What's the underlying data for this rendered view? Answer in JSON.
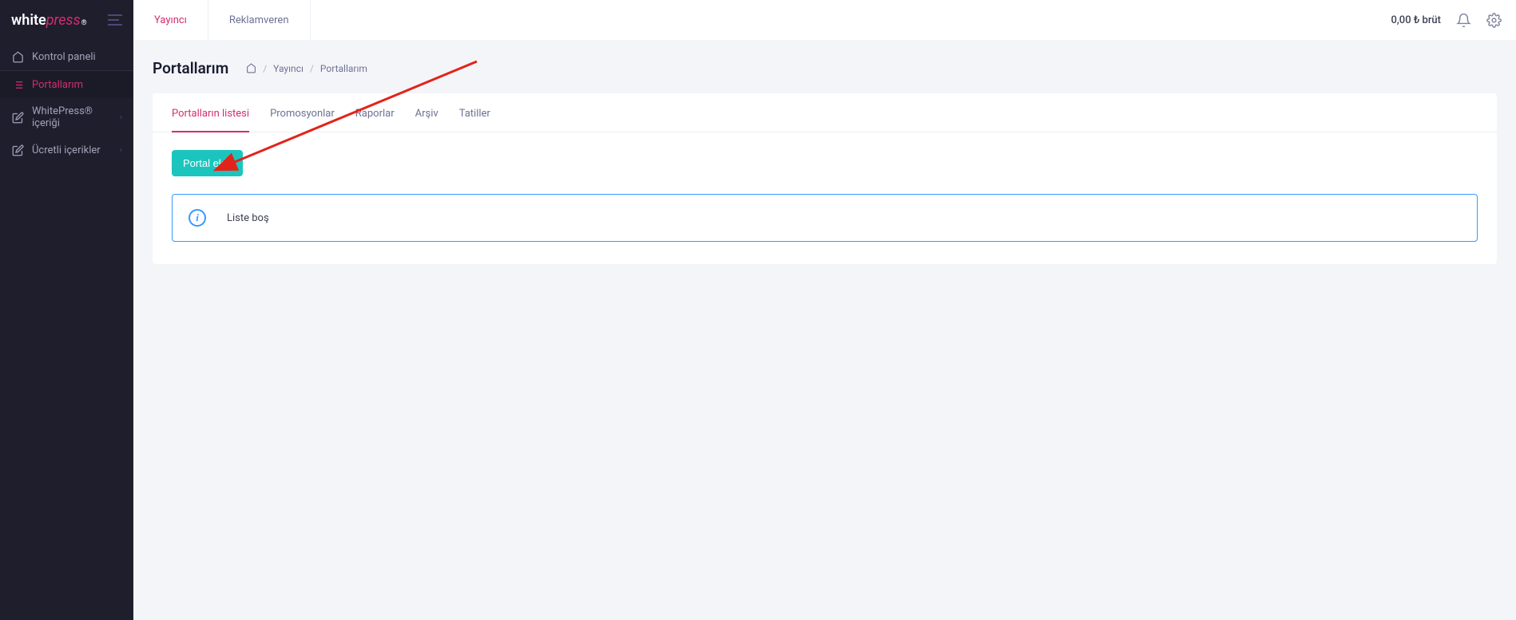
{
  "logo": {
    "part1": "white",
    "part2": "press",
    "reg": "®"
  },
  "sidebar": {
    "items": [
      {
        "label": "Kontrol paneli",
        "icon": "home"
      },
      {
        "label": "Portallarım",
        "icon": "list"
      },
      {
        "label": "WhitePress® içeriği",
        "icon": "edit",
        "expandable": true
      },
      {
        "label": "Ücretli içerikler",
        "icon": "edit",
        "expandable": true
      }
    ]
  },
  "topbar": {
    "tabs": [
      {
        "label": "Yayıncı",
        "active": true
      },
      {
        "label": "Reklamveren",
        "active": false
      }
    ],
    "balance": "0,00 ₺ brüt"
  },
  "page": {
    "title": "Portallarım"
  },
  "breadcrumb": {
    "items": [
      {
        "label": "Yayıncı"
      },
      {
        "label": "Portallarım"
      }
    ],
    "sep": "/"
  },
  "inner_tabs": [
    {
      "label": "Portalların listesi",
      "active": true
    },
    {
      "label": "Promosyonlar"
    },
    {
      "label": "Raporlar"
    },
    {
      "label": "Arşiv"
    },
    {
      "label": "Tatiller"
    }
  ],
  "buttons": {
    "add_portal": "Portal ekle"
  },
  "info": {
    "message": "Liste boş"
  }
}
